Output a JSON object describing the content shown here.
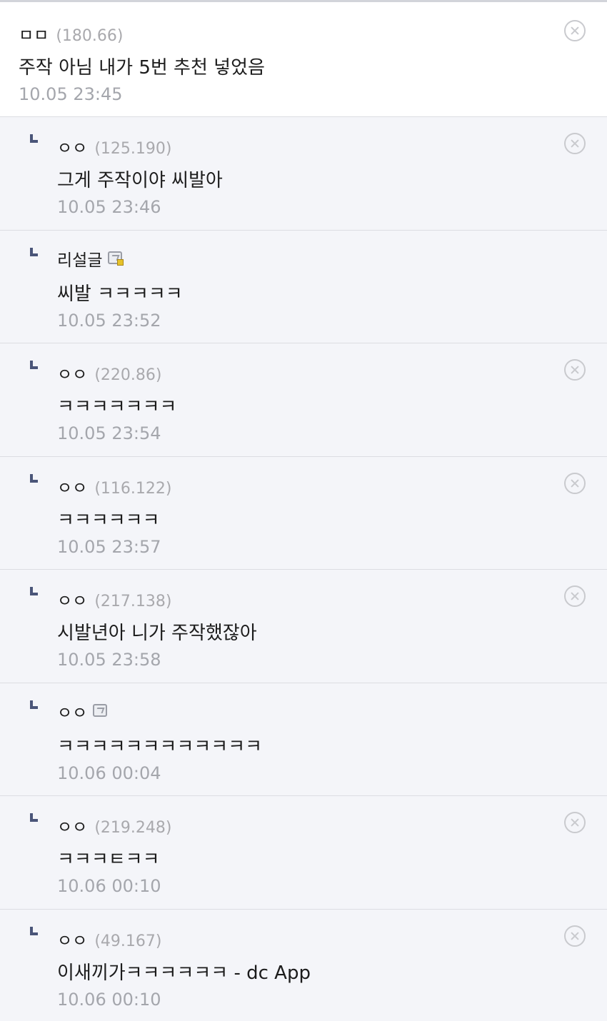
{
  "comments": [
    {
      "nick": "ㅁㅁ",
      "ip": "(180.66)",
      "text": "주작 아님 내가 5번 추천 넣었음",
      "date": "10.05 23:45",
      "deletable": true,
      "reply": false
    },
    {
      "nick": "ㅇㅇ",
      "ip": "(125.190)",
      "text": "그게 주작이야 씨발아",
      "date": "10.05 23:46",
      "deletable": true,
      "reply": true
    },
    {
      "nick": "리설글",
      "ip": "",
      "text": "씨발 ㅋㅋㅋㅋㅋ",
      "date": "10.05 23:52",
      "deletable": false,
      "reply": true,
      "badge": "gallog-fixed-user-icon"
    },
    {
      "nick": "ㅇㅇ",
      "ip": "(220.86)",
      "text": "ㅋㅋㅋㅋㅋㅋㅋ",
      "date": "10.05 23:54",
      "deletable": true,
      "reply": true
    },
    {
      "nick": "ㅇㅇ",
      "ip": "(116.122)",
      "text": "ㅋㅋㅋㅋㅋㅋ",
      "date": "10.05 23:57",
      "deletable": true,
      "reply": true
    },
    {
      "nick": "ㅇㅇ",
      "ip": "(217.138)",
      "text": "시발년아 니가 주작했잖아",
      "date": "10.05 23:58",
      "deletable": true,
      "reply": true
    },
    {
      "nick": "ㅇㅇ",
      "ip": "",
      "text": "ㅋㅋㅋㅋㅋㅋㅋㅋㅋㅋㅋㅋ",
      "date": "10.06 00:04",
      "deletable": false,
      "reply": true,
      "badge": "gallog-user-icon"
    },
    {
      "nick": "ㅇㅇ",
      "ip": "(219.248)",
      "text": "ㅋㅋㅋㅌㅋㅋ",
      "date": "10.06 00:10",
      "deletable": true,
      "reply": true
    },
    {
      "nick": "ㅇㅇ",
      "ip": "(49.167)",
      "text": "이새끼가ㅋㅋㅋㅋㅋㅋ - dc App",
      "date": "10.06 00:10",
      "deletable": true,
      "reply": true
    }
  ]
}
